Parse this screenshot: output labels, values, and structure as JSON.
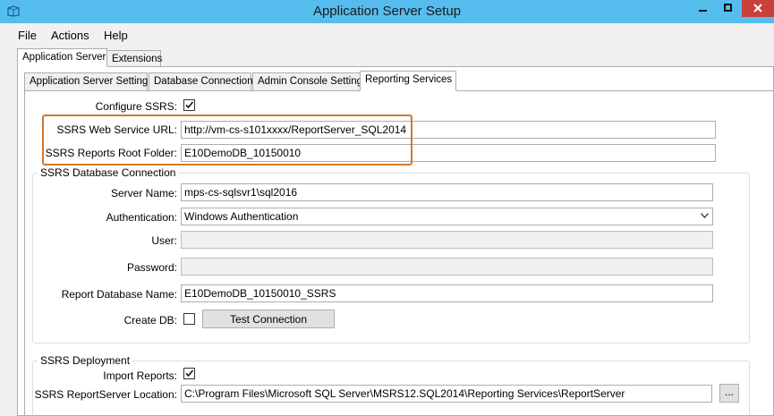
{
  "window": {
    "title": "Application Server Setup"
  },
  "menu": {
    "file": "File",
    "actions": "Actions",
    "help": "Help"
  },
  "outer_tabs": {
    "application_server": "Application Server",
    "extensions": "Extensions"
  },
  "inner_tabs": {
    "app_server_settings": "Application Server Settings",
    "database_connection": "Database Connection",
    "admin_console_settings": "Admin Console Settings",
    "reporting_services": "Reporting Services"
  },
  "form": {
    "configure_ssrs_label": "Configure SSRS:",
    "configure_ssrs_checked": true,
    "web_service_url_label": "SSRS Web Service URL:",
    "web_service_url_value": "http://vm-cs-s101xxxx/ReportServer_SQL2014",
    "reports_root_folder_label": "SSRS Reports Root Folder:",
    "reports_root_folder_value": "E10DemoDB_10150010"
  },
  "db_connection": {
    "group_title": "SSRS Database Connection",
    "server_name_label": "Server Name:",
    "server_name_value": "mps-cs-sqlsvr1\\sql2016",
    "authentication_label": "Authentication:",
    "authentication_value": "Windows Authentication",
    "user_label": "User:",
    "user_value": "",
    "password_label": "Password:",
    "password_value": "",
    "report_db_name_label": "Report Database Name:",
    "report_db_name_value": "E10DemoDB_10150010_SSRS",
    "create_db_label": "Create DB:",
    "create_db_checked": false,
    "test_connection_label": "Test Connection"
  },
  "deployment": {
    "group_title": "SSRS Deployment",
    "import_reports_label": "Import Reports:",
    "import_reports_checked": true,
    "reportserver_location_label": "SSRS ReportServer Location:",
    "reportserver_location_value": "C:\\Program Files\\Microsoft SQL Server\\MSRS12.SQL2014\\Reporting Services\\ReportServer",
    "browse_label": "..."
  },
  "colors": {
    "titlebar": "#55bdee",
    "close_button": "#c7403a",
    "highlight_border": "#d4772a"
  }
}
